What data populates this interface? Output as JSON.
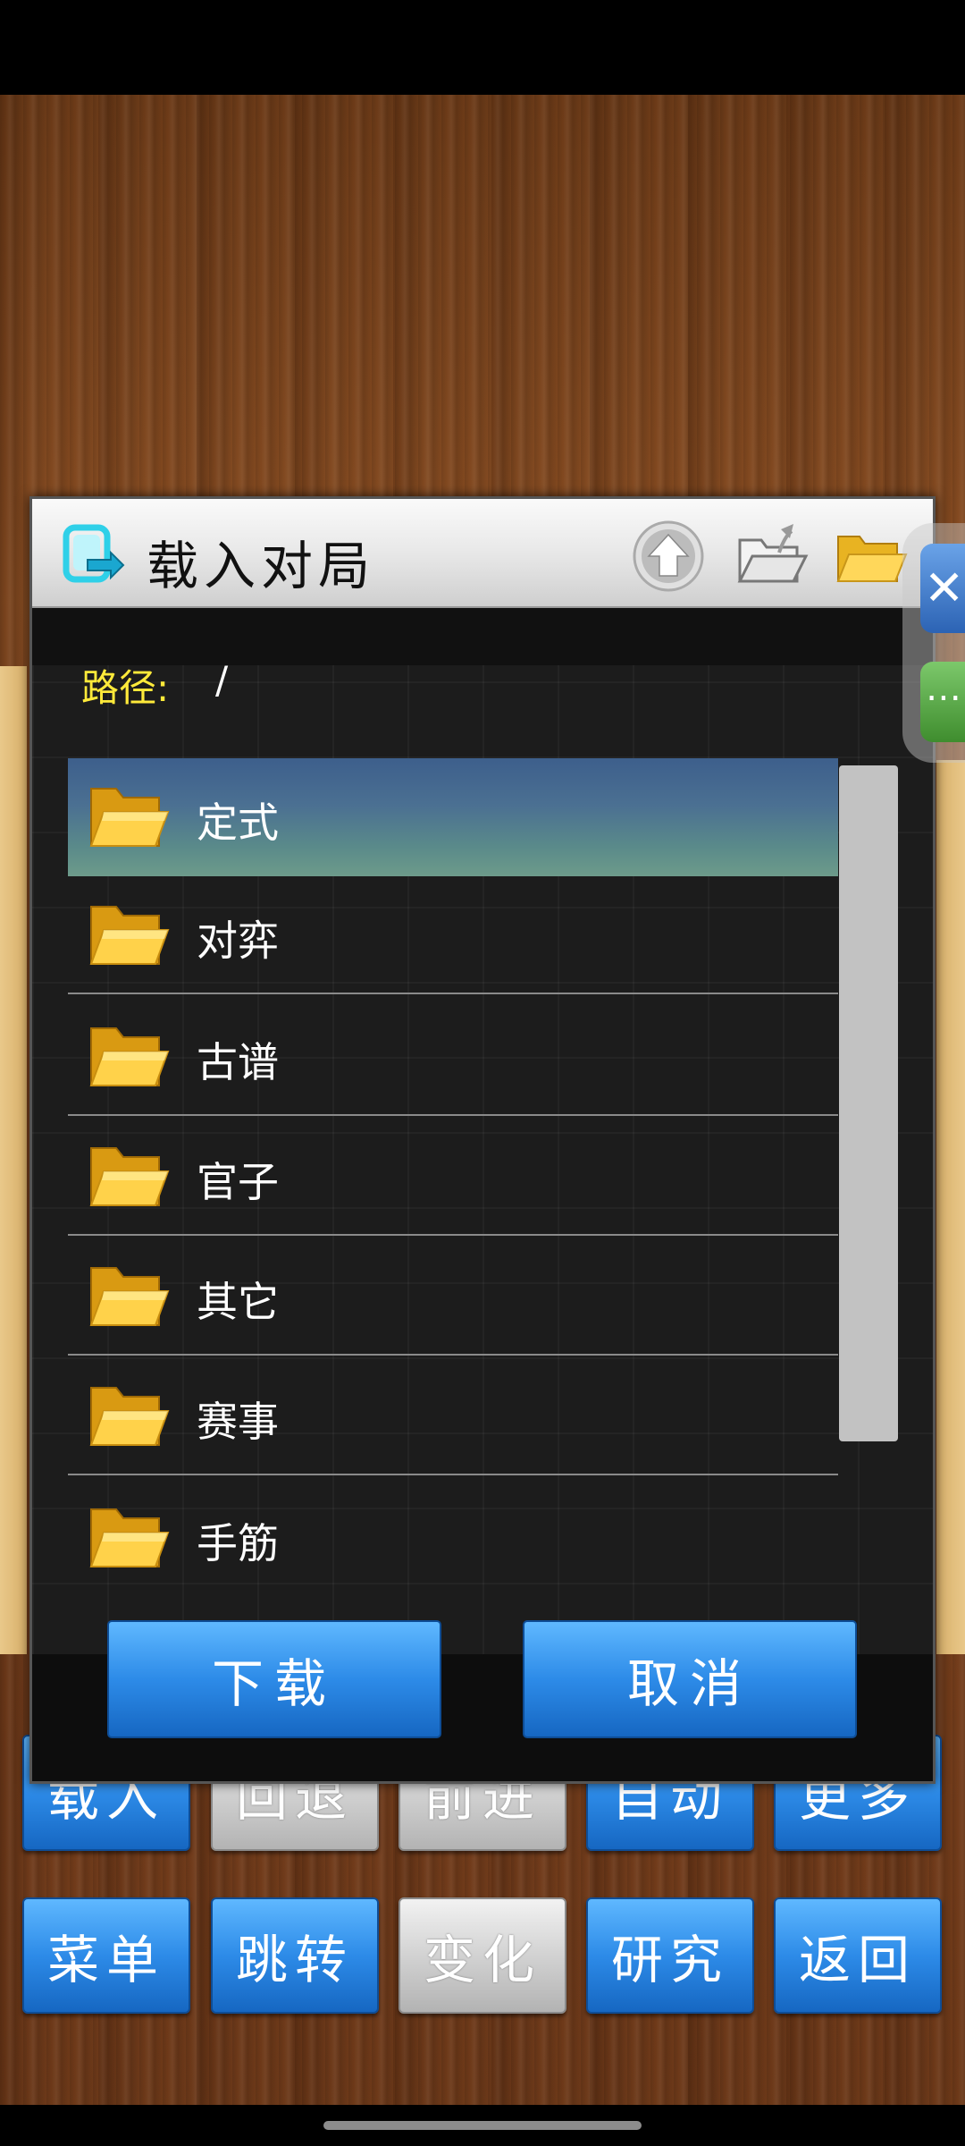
{
  "dialog": {
    "title": "载入对局",
    "path_label": "路径:",
    "path_value": "/",
    "folders": [
      {
        "label": "定式",
        "selected": true
      },
      {
        "label": "对弈",
        "selected": false
      },
      {
        "label": "古谱",
        "selected": false
      },
      {
        "label": "官子",
        "selected": false
      },
      {
        "label": "其它",
        "selected": false
      },
      {
        "label": "赛事",
        "selected": false
      },
      {
        "label": "手筋",
        "selected": false
      }
    ],
    "download_label": "下载",
    "cancel_label": "取消",
    "icons": {
      "title": "load-file-icon",
      "up": "up-arrow-icon",
      "open_folder": "open-folder-icon",
      "folder": "folder-icon"
    }
  },
  "toolbar": {
    "row1": [
      "载入",
      "回退",
      "前进",
      "自动",
      "更多"
    ],
    "row2": [
      "菜单",
      "跳转",
      "变化",
      "研究",
      "返回"
    ]
  },
  "side_panel": {
    "blue_glyph": "✕",
    "green_glyph": "⋯"
  }
}
